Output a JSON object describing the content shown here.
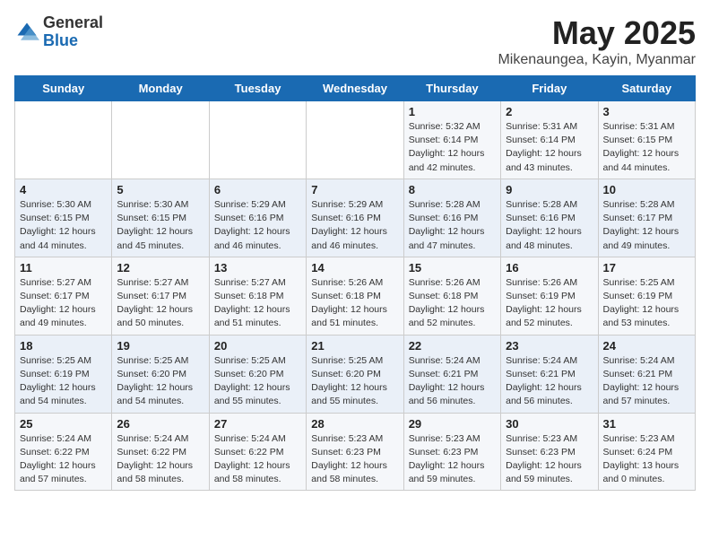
{
  "logo": {
    "general": "General",
    "blue": "Blue"
  },
  "title": "May 2025",
  "subtitle": "Mikenaungea, Kayin, Myanmar",
  "days_of_week": [
    "Sunday",
    "Monday",
    "Tuesday",
    "Wednesday",
    "Thursday",
    "Friday",
    "Saturday"
  ],
  "weeks": [
    [
      {
        "num": "",
        "info": ""
      },
      {
        "num": "",
        "info": ""
      },
      {
        "num": "",
        "info": ""
      },
      {
        "num": "",
        "info": ""
      },
      {
        "num": "1",
        "info": "Sunrise: 5:32 AM\nSunset: 6:14 PM\nDaylight: 12 hours\nand 42 minutes."
      },
      {
        "num": "2",
        "info": "Sunrise: 5:31 AM\nSunset: 6:14 PM\nDaylight: 12 hours\nand 43 minutes."
      },
      {
        "num": "3",
        "info": "Sunrise: 5:31 AM\nSunset: 6:15 PM\nDaylight: 12 hours\nand 44 minutes."
      }
    ],
    [
      {
        "num": "4",
        "info": "Sunrise: 5:30 AM\nSunset: 6:15 PM\nDaylight: 12 hours\nand 44 minutes."
      },
      {
        "num": "5",
        "info": "Sunrise: 5:30 AM\nSunset: 6:15 PM\nDaylight: 12 hours\nand 45 minutes."
      },
      {
        "num": "6",
        "info": "Sunrise: 5:29 AM\nSunset: 6:16 PM\nDaylight: 12 hours\nand 46 minutes."
      },
      {
        "num": "7",
        "info": "Sunrise: 5:29 AM\nSunset: 6:16 PM\nDaylight: 12 hours\nand 46 minutes."
      },
      {
        "num": "8",
        "info": "Sunrise: 5:28 AM\nSunset: 6:16 PM\nDaylight: 12 hours\nand 47 minutes."
      },
      {
        "num": "9",
        "info": "Sunrise: 5:28 AM\nSunset: 6:16 PM\nDaylight: 12 hours\nand 48 minutes."
      },
      {
        "num": "10",
        "info": "Sunrise: 5:28 AM\nSunset: 6:17 PM\nDaylight: 12 hours\nand 49 minutes."
      }
    ],
    [
      {
        "num": "11",
        "info": "Sunrise: 5:27 AM\nSunset: 6:17 PM\nDaylight: 12 hours\nand 49 minutes."
      },
      {
        "num": "12",
        "info": "Sunrise: 5:27 AM\nSunset: 6:17 PM\nDaylight: 12 hours\nand 50 minutes."
      },
      {
        "num": "13",
        "info": "Sunrise: 5:27 AM\nSunset: 6:18 PM\nDaylight: 12 hours\nand 51 minutes."
      },
      {
        "num": "14",
        "info": "Sunrise: 5:26 AM\nSunset: 6:18 PM\nDaylight: 12 hours\nand 51 minutes."
      },
      {
        "num": "15",
        "info": "Sunrise: 5:26 AM\nSunset: 6:18 PM\nDaylight: 12 hours\nand 52 minutes."
      },
      {
        "num": "16",
        "info": "Sunrise: 5:26 AM\nSunset: 6:19 PM\nDaylight: 12 hours\nand 52 minutes."
      },
      {
        "num": "17",
        "info": "Sunrise: 5:25 AM\nSunset: 6:19 PM\nDaylight: 12 hours\nand 53 minutes."
      }
    ],
    [
      {
        "num": "18",
        "info": "Sunrise: 5:25 AM\nSunset: 6:19 PM\nDaylight: 12 hours\nand 54 minutes."
      },
      {
        "num": "19",
        "info": "Sunrise: 5:25 AM\nSunset: 6:20 PM\nDaylight: 12 hours\nand 54 minutes."
      },
      {
        "num": "20",
        "info": "Sunrise: 5:25 AM\nSunset: 6:20 PM\nDaylight: 12 hours\nand 55 minutes."
      },
      {
        "num": "21",
        "info": "Sunrise: 5:25 AM\nSunset: 6:20 PM\nDaylight: 12 hours\nand 55 minutes."
      },
      {
        "num": "22",
        "info": "Sunrise: 5:24 AM\nSunset: 6:21 PM\nDaylight: 12 hours\nand 56 minutes."
      },
      {
        "num": "23",
        "info": "Sunrise: 5:24 AM\nSunset: 6:21 PM\nDaylight: 12 hours\nand 56 minutes."
      },
      {
        "num": "24",
        "info": "Sunrise: 5:24 AM\nSunset: 6:21 PM\nDaylight: 12 hours\nand 57 minutes."
      }
    ],
    [
      {
        "num": "25",
        "info": "Sunrise: 5:24 AM\nSunset: 6:22 PM\nDaylight: 12 hours\nand 57 minutes."
      },
      {
        "num": "26",
        "info": "Sunrise: 5:24 AM\nSunset: 6:22 PM\nDaylight: 12 hours\nand 58 minutes."
      },
      {
        "num": "27",
        "info": "Sunrise: 5:24 AM\nSunset: 6:22 PM\nDaylight: 12 hours\nand 58 minutes."
      },
      {
        "num": "28",
        "info": "Sunrise: 5:23 AM\nSunset: 6:23 PM\nDaylight: 12 hours\nand 58 minutes."
      },
      {
        "num": "29",
        "info": "Sunrise: 5:23 AM\nSunset: 6:23 PM\nDaylight: 12 hours\nand 59 minutes."
      },
      {
        "num": "30",
        "info": "Sunrise: 5:23 AM\nSunset: 6:23 PM\nDaylight: 12 hours\nand 59 minutes."
      },
      {
        "num": "31",
        "info": "Sunrise: 5:23 AM\nSunset: 6:24 PM\nDaylight: 13 hours\nand 0 minutes."
      }
    ]
  ]
}
